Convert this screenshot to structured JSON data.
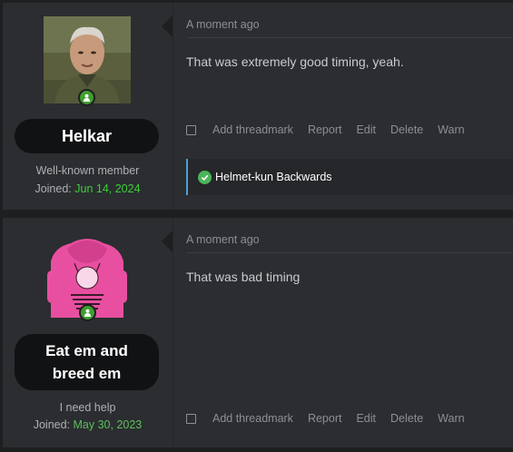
{
  "posts": [
    {
      "author": "Helkar",
      "user_title": "Well-known member",
      "joined_label": "Joined:",
      "joined_date": "Jun 14, 2024",
      "timestamp": "A moment ago",
      "message": "That was extremely good timing, yeah.",
      "actions": [
        "Add threadmark",
        "Report",
        "Edit",
        "Delete",
        "Warn"
      ],
      "reaction_users": "Helmet-kun Backwards",
      "online": true
    },
    {
      "author": "Eat em and breed em",
      "user_title": "I need help",
      "joined_label": "Joined:",
      "joined_date": "May 30, 2023",
      "timestamp": "A moment ago",
      "message": "That was bad timing",
      "actions": [
        "Add threadmark",
        "Report",
        "Edit",
        "Delete",
        "Warn"
      ],
      "online": true
    }
  ],
  "colors": {
    "page_bg": "#1d1f21",
    "post_bg": "#2b2d30",
    "accent_blue": "#4a9fd4",
    "online_green": "#3f9e2f",
    "joined_green": "#3fcf3a"
  },
  "icons": {
    "online": "user-online-icon",
    "reaction": "like-check-icon"
  }
}
